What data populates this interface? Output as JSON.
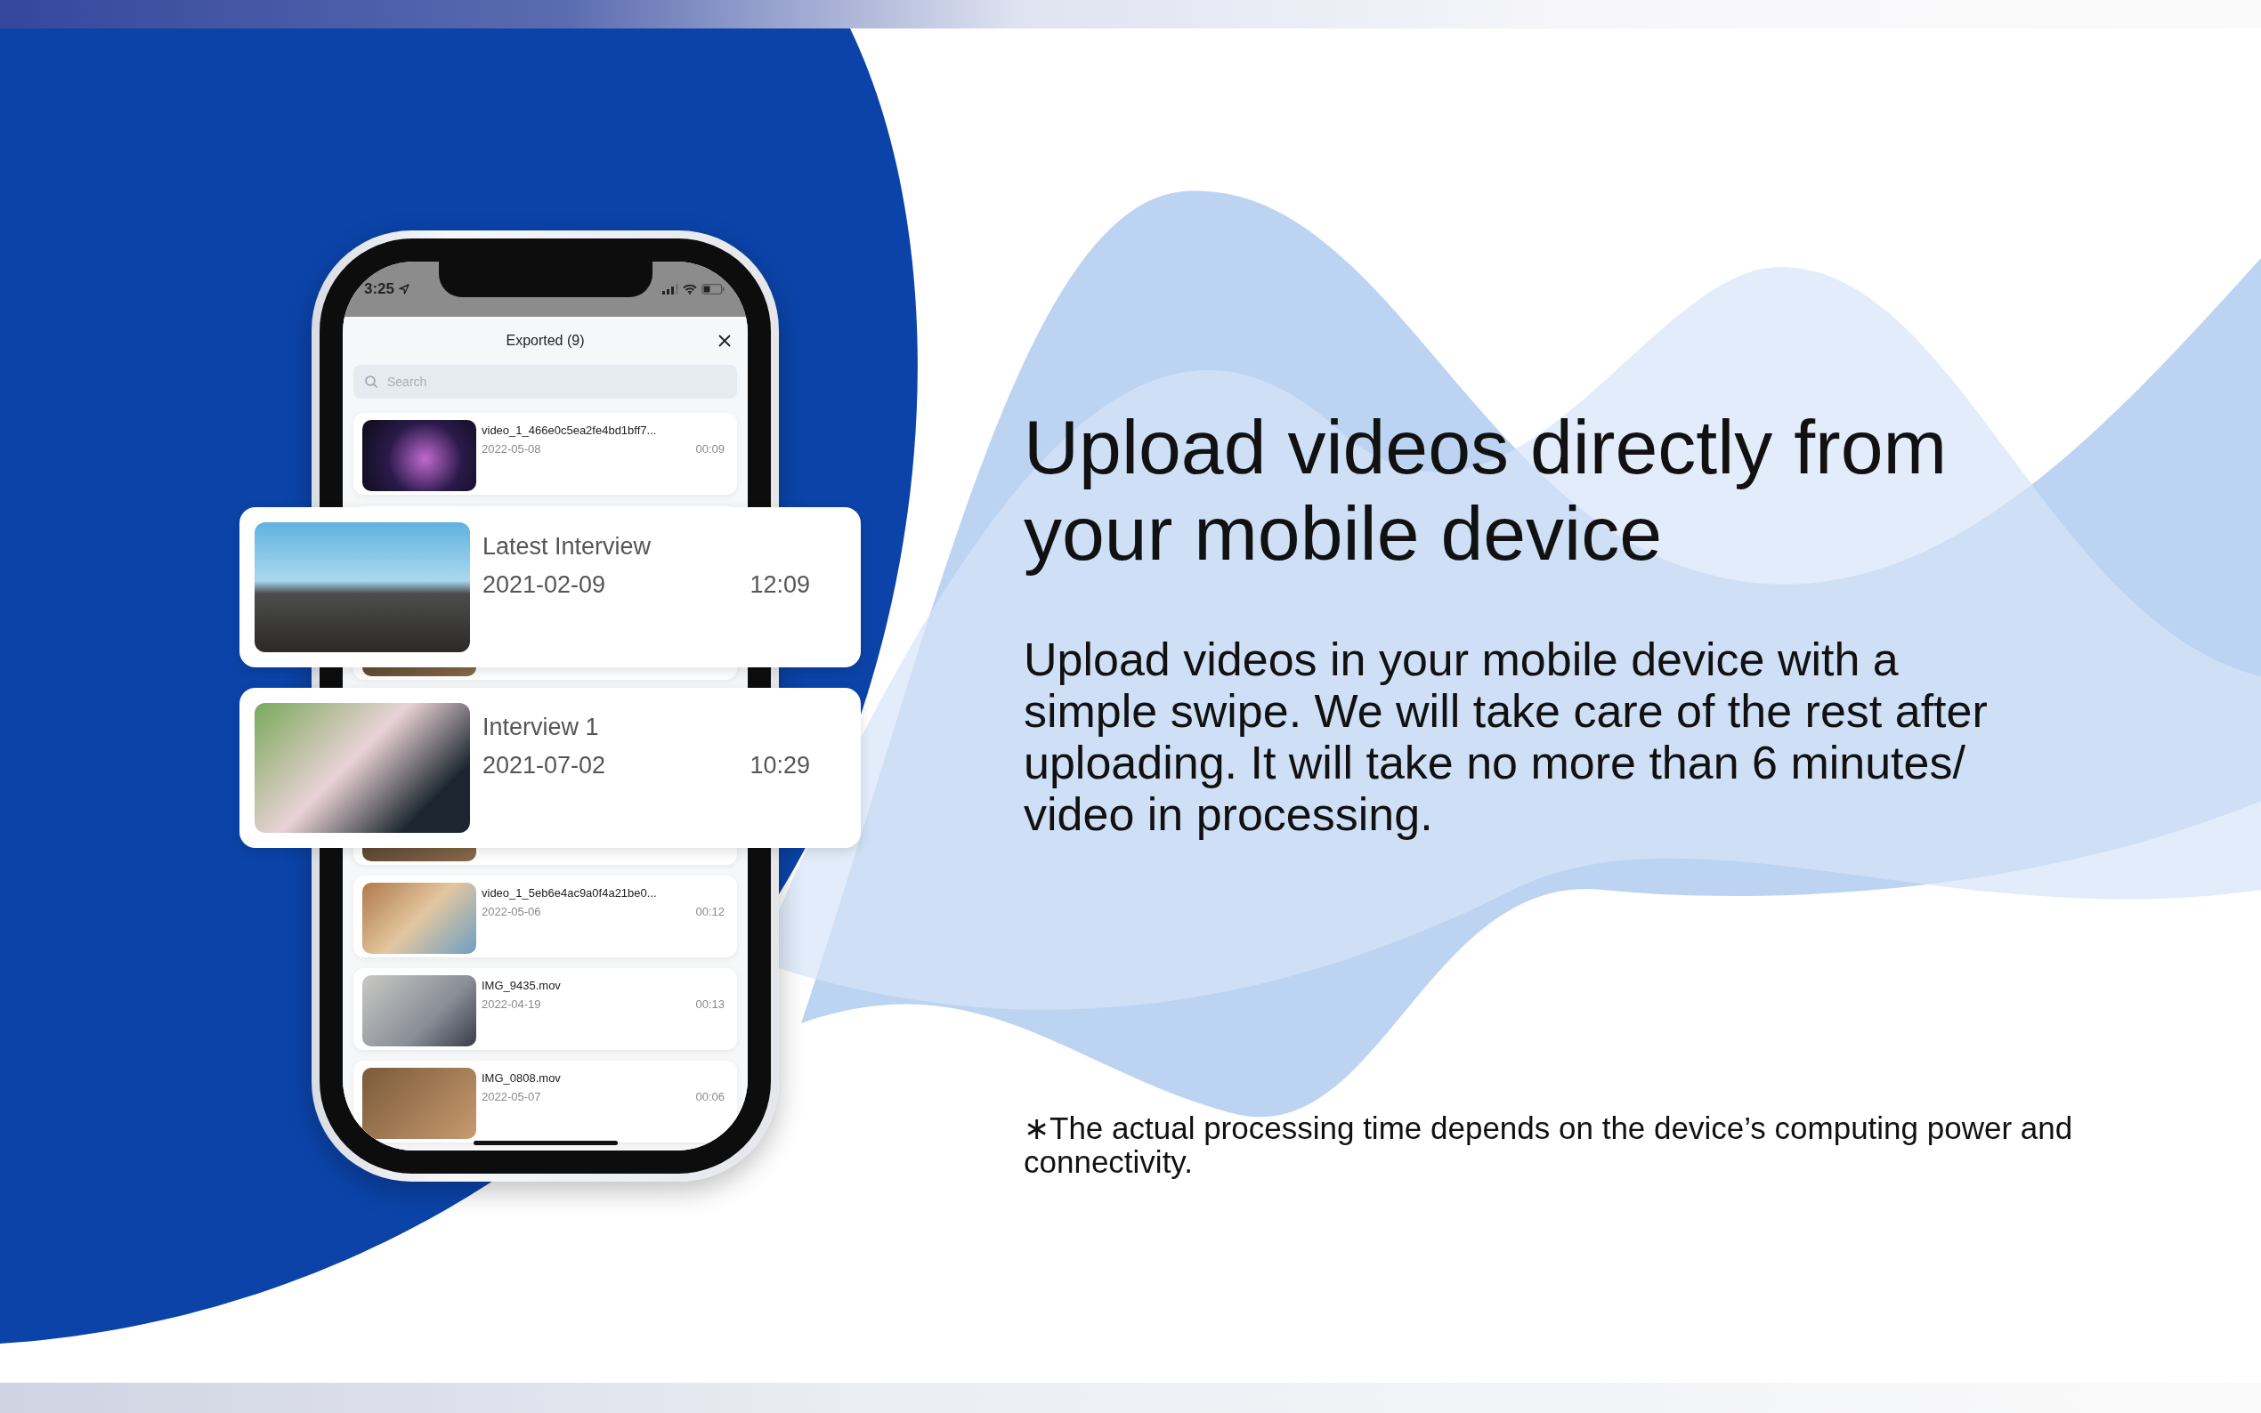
{
  "phone": {
    "status_bar": {
      "time": "3:25"
    },
    "sheet": {
      "title": "Exported (9)",
      "search": {
        "placeholder": "Search"
      },
      "items_top": [
        {
          "name": "video_1_466e0c5ea2fe4bd1bff7...",
          "date": "2022-05-08",
          "duration": "00:09"
        }
      ],
      "items_bottom": [
        {
          "name": "video_1_5eb6e4ac9a0f4a21be0...",
          "date": "2022-05-06",
          "duration": "00:12"
        },
        {
          "name": "IMG_9435.mov",
          "date": "2022-04-19",
          "duration": "00:13"
        },
        {
          "name": "IMG_0808.mov",
          "date": "2022-05-07",
          "duration": "00:06"
        }
      ]
    }
  },
  "cards": [
    {
      "title": "Latest Interview",
      "date": "2021-02-09",
      "duration": "12:09"
    },
    {
      "title": "Interview 1",
      "date": "2021-07-02",
      "duration": "10:29"
    }
  ],
  "heading": "Upload videos directly from your mobile device",
  "description": "Upload videos in your mobile device with a simple swipe. We will take care of the rest after uploading. It will take no more than 6 minutes/ video in processing.",
  "footnote": "∗The actual processing time depends on the device’s computing power and connectivity."
}
